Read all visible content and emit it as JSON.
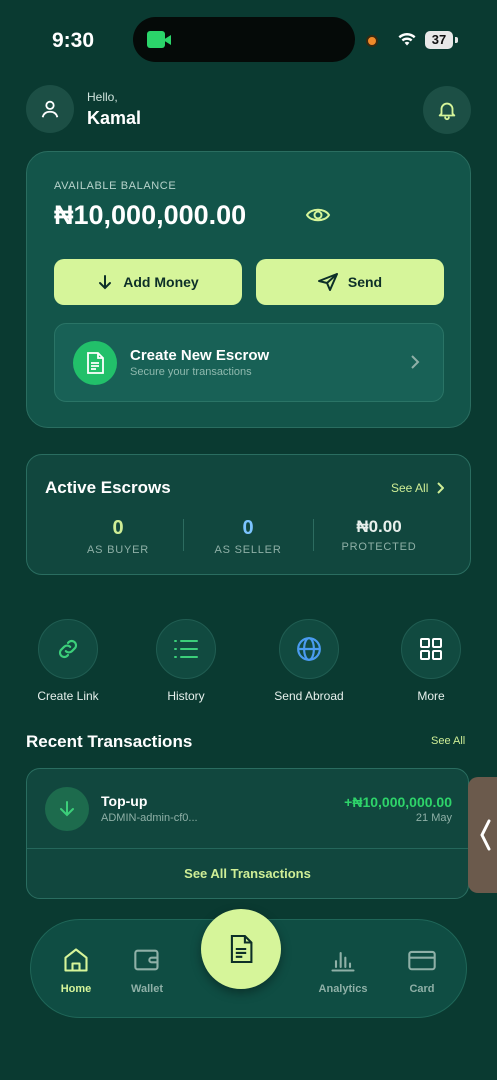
{
  "status_bar": {
    "time": "9:30",
    "battery": "37"
  },
  "header": {
    "greeting": "Hello,",
    "user_name": "Kamal"
  },
  "balance": {
    "label": "AVAILABLE BALANCE",
    "amount": "₦10,000,000.00"
  },
  "actions": {
    "add_money": "Add Money",
    "send": "Send"
  },
  "escrow_cta": {
    "title": "Create New Escrow",
    "subtitle": "Secure your transactions"
  },
  "active_escrows": {
    "title": "Active Escrows",
    "see_all": "See All",
    "stats": [
      {
        "value": "0",
        "label": "AS BUYER",
        "color": "#cfee96"
      },
      {
        "value": "0",
        "label": "AS SELLER",
        "color": "#7cc4ff"
      },
      {
        "value": "₦0.00",
        "label": "PROTECTED",
        "color": "#e8f0ec"
      }
    ]
  },
  "quick_actions": [
    {
      "label": "Create Link",
      "icon": "link-icon"
    },
    {
      "label": "History",
      "icon": "list-icon"
    },
    {
      "label": "Send Abroad",
      "icon": "globe-icon"
    },
    {
      "label": "More",
      "icon": "grid-icon"
    }
  ],
  "recent": {
    "title": "Recent Transactions",
    "see_all": "See All",
    "items": [
      {
        "name": "Top-up",
        "ref": "ADMIN-admin-cf0...",
        "amount": "+₦10,000,000.00",
        "date": "21 May"
      }
    ],
    "see_all_transactions": "See All Transactions"
  },
  "nav": {
    "items": [
      {
        "label": "Home",
        "icon": "home-icon",
        "active": true
      },
      {
        "label": "Wallet",
        "icon": "wallet-icon",
        "active": false
      },
      {
        "label": "Analytics",
        "icon": "bar-chart-icon",
        "active": false
      },
      {
        "label": "Card",
        "icon": "card-icon",
        "active": false
      }
    ]
  },
  "colors": {
    "background": "#0a3a31",
    "accent": "#d6f59a",
    "positive": "#2ed46a"
  }
}
